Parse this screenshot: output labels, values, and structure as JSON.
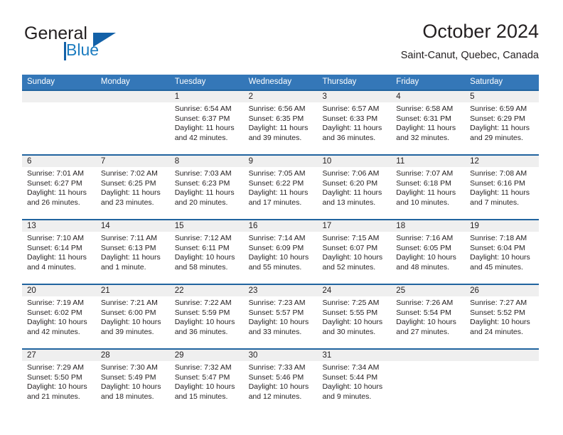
{
  "brand": {
    "name_part1": "General",
    "name_part2": "Blue",
    "logo_icon": "triangle-logo"
  },
  "header": {
    "title": "October 2024",
    "subtitle": "Saint-Canut, Quebec, Canada"
  },
  "colors": {
    "header_blue": "#3477b8",
    "row_border_blue": "#21649f",
    "day_band_gray": "#efefef",
    "brand_blue": "#1361a8",
    "text": "#231f20"
  },
  "weekdays": [
    "Sunday",
    "Monday",
    "Tuesday",
    "Wednesday",
    "Thursday",
    "Friday",
    "Saturday"
  ],
  "weeks": [
    [
      {
        "day": "",
        "lines": []
      },
      {
        "day": "",
        "lines": []
      },
      {
        "day": "1",
        "lines": [
          "Sunrise: 6:54 AM",
          "Sunset: 6:37 PM",
          "Daylight: 11 hours",
          "and 42 minutes."
        ]
      },
      {
        "day": "2",
        "lines": [
          "Sunrise: 6:56 AM",
          "Sunset: 6:35 PM",
          "Daylight: 11 hours",
          "and 39 minutes."
        ]
      },
      {
        "day": "3",
        "lines": [
          "Sunrise: 6:57 AM",
          "Sunset: 6:33 PM",
          "Daylight: 11 hours",
          "and 36 minutes."
        ]
      },
      {
        "day": "4",
        "lines": [
          "Sunrise: 6:58 AM",
          "Sunset: 6:31 PM",
          "Daylight: 11 hours",
          "and 32 minutes."
        ]
      },
      {
        "day": "5",
        "lines": [
          "Sunrise: 6:59 AM",
          "Sunset: 6:29 PM",
          "Daylight: 11 hours",
          "and 29 minutes."
        ]
      }
    ],
    [
      {
        "day": "6",
        "lines": [
          "Sunrise: 7:01 AM",
          "Sunset: 6:27 PM",
          "Daylight: 11 hours",
          "and 26 minutes."
        ]
      },
      {
        "day": "7",
        "lines": [
          "Sunrise: 7:02 AM",
          "Sunset: 6:25 PM",
          "Daylight: 11 hours",
          "and 23 minutes."
        ]
      },
      {
        "day": "8",
        "lines": [
          "Sunrise: 7:03 AM",
          "Sunset: 6:23 PM",
          "Daylight: 11 hours",
          "and 20 minutes."
        ]
      },
      {
        "day": "9",
        "lines": [
          "Sunrise: 7:05 AM",
          "Sunset: 6:22 PM",
          "Daylight: 11 hours",
          "and 17 minutes."
        ]
      },
      {
        "day": "10",
        "lines": [
          "Sunrise: 7:06 AM",
          "Sunset: 6:20 PM",
          "Daylight: 11 hours",
          "and 13 minutes."
        ]
      },
      {
        "day": "11",
        "lines": [
          "Sunrise: 7:07 AM",
          "Sunset: 6:18 PM",
          "Daylight: 11 hours",
          "and 10 minutes."
        ]
      },
      {
        "day": "12",
        "lines": [
          "Sunrise: 7:08 AM",
          "Sunset: 6:16 PM",
          "Daylight: 11 hours",
          "and 7 minutes."
        ]
      }
    ],
    [
      {
        "day": "13",
        "lines": [
          "Sunrise: 7:10 AM",
          "Sunset: 6:14 PM",
          "Daylight: 11 hours",
          "and 4 minutes."
        ]
      },
      {
        "day": "14",
        "lines": [
          "Sunrise: 7:11 AM",
          "Sunset: 6:13 PM",
          "Daylight: 11 hours",
          "and 1 minute."
        ]
      },
      {
        "day": "15",
        "lines": [
          "Sunrise: 7:12 AM",
          "Sunset: 6:11 PM",
          "Daylight: 10 hours",
          "and 58 minutes."
        ]
      },
      {
        "day": "16",
        "lines": [
          "Sunrise: 7:14 AM",
          "Sunset: 6:09 PM",
          "Daylight: 10 hours",
          "and 55 minutes."
        ]
      },
      {
        "day": "17",
        "lines": [
          "Sunrise: 7:15 AM",
          "Sunset: 6:07 PM",
          "Daylight: 10 hours",
          "and 52 minutes."
        ]
      },
      {
        "day": "18",
        "lines": [
          "Sunrise: 7:16 AM",
          "Sunset: 6:05 PM",
          "Daylight: 10 hours",
          "and 48 minutes."
        ]
      },
      {
        "day": "19",
        "lines": [
          "Sunrise: 7:18 AM",
          "Sunset: 6:04 PM",
          "Daylight: 10 hours",
          "and 45 minutes."
        ]
      }
    ],
    [
      {
        "day": "20",
        "lines": [
          "Sunrise: 7:19 AM",
          "Sunset: 6:02 PM",
          "Daylight: 10 hours",
          "and 42 minutes."
        ]
      },
      {
        "day": "21",
        "lines": [
          "Sunrise: 7:21 AM",
          "Sunset: 6:00 PM",
          "Daylight: 10 hours",
          "and 39 minutes."
        ]
      },
      {
        "day": "22",
        "lines": [
          "Sunrise: 7:22 AM",
          "Sunset: 5:59 PM",
          "Daylight: 10 hours",
          "and 36 minutes."
        ]
      },
      {
        "day": "23",
        "lines": [
          "Sunrise: 7:23 AM",
          "Sunset: 5:57 PM",
          "Daylight: 10 hours",
          "and 33 minutes."
        ]
      },
      {
        "day": "24",
        "lines": [
          "Sunrise: 7:25 AM",
          "Sunset: 5:55 PM",
          "Daylight: 10 hours",
          "and 30 minutes."
        ]
      },
      {
        "day": "25",
        "lines": [
          "Sunrise: 7:26 AM",
          "Sunset: 5:54 PM",
          "Daylight: 10 hours",
          "and 27 minutes."
        ]
      },
      {
        "day": "26",
        "lines": [
          "Sunrise: 7:27 AM",
          "Sunset: 5:52 PM",
          "Daylight: 10 hours",
          "and 24 minutes."
        ]
      }
    ],
    [
      {
        "day": "27",
        "lines": [
          "Sunrise: 7:29 AM",
          "Sunset: 5:50 PM",
          "Daylight: 10 hours",
          "and 21 minutes."
        ]
      },
      {
        "day": "28",
        "lines": [
          "Sunrise: 7:30 AM",
          "Sunset: 5:49 PM",
          "Daylight: 10 hours",
          "and 18 minutes."
        ]
      },
      {
        "day": "29",
        "lines": [
          "Sunrise: 7:32 AM",
          "Sunset: 5:47 PM",
          "Daylight: 10 hours",
          "and 15 minutes."
        ]
      },
      {
        "day": "30",
        "lines": [
          "Sunrise: 7:33 AM",
          "Sunset: 5:46 PM",
          "Daylight: 10 hours",
          "and 12 minutes."
        ]
      },
      {
        "day": "31",
        "lines": [
          "Sunrise: 7:34 AM",
          "Sunset: 5:44 PM",
          "Daylight: 10 hours",
          "and 9 minutes."
        ]
      },
      {
        "day": "",
        "lines": []
      },
      {
        "day": "",
        "lines": []
      }
    ]
  ]
}
